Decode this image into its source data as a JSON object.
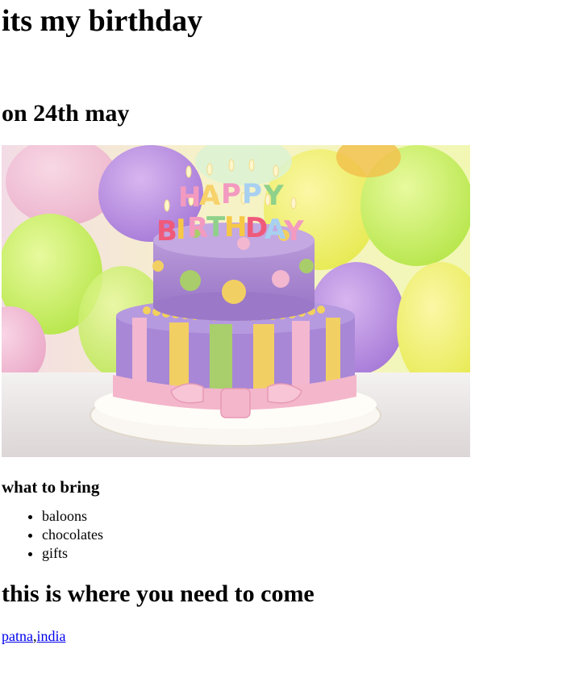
{
  "page": {
    "title": "its my birthday",
    "date": "on 24th may",
    "photo": {
      "alt": "birthday cake",
      "candle_letters": "HAPPY BIRTHDAY"
    },
    "bring_heading": "what to bring",
    "bring_items": [
      "baloons",
      "chocolates",
      "gifts"
    ],
    "where_heading": "this is where you need to come",
    "location": {
      "city": "patna",
      "separator": ",",
      "country": "india"
    }
  },
  "colors": {
    "link": "#0000ee",
    "text": "#000000",
    "background": "#ffffff"
  }
}
